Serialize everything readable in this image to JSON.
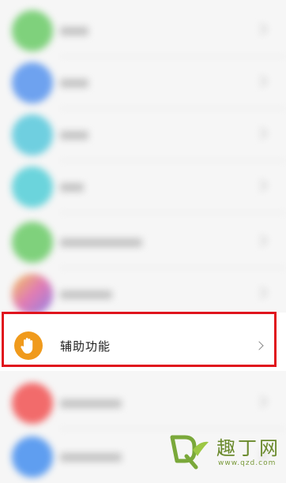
{
  "accessibility_item": {
    "label": "辅助功能",
    "icon": "hand-icon",
    "icon_color": "#f09a1c"
  },
  "highlight_color": "#e0141d",
  "watermark": {
    "text": "趣丁网",
    "url": "www.qzd.com"
  }
}
